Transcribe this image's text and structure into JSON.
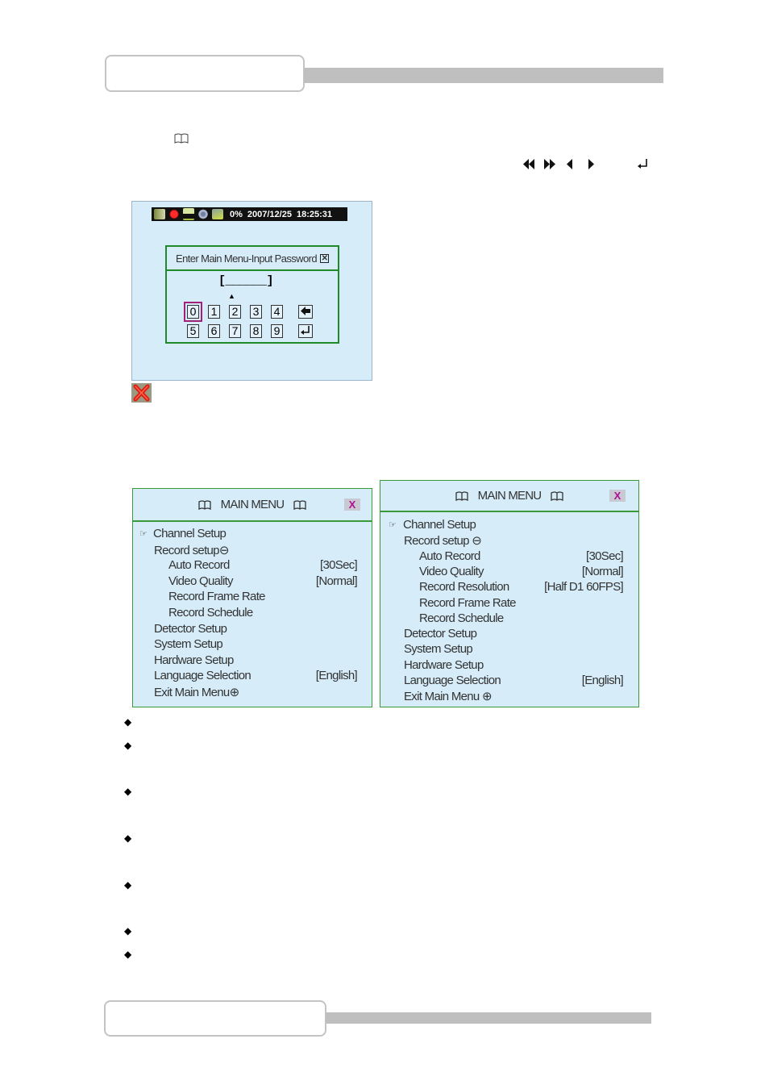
{
  "page": {
    "header_tab_label": "",
    "footer_tab_label": "",
    "note_icon": "book-icon",
    "nav_keys": [
      "fast-rewind-icon",
      "fast-forward-icon",
      "left-icon",
      "right-icon",
      "enter-icon"
    ],
    "nav_glyphs": {
      "rewind": "◀◀",
      "forward": "▶▶",
      "left": "◀",
      "right": "▶",
      "enter": "↵"
    }
  },
  "password_screen": {
    "status_bar": {
      "icons": [
        "camera-icon",
        "record-icon",
        "network-icon",
        "disk-icon",
        "hdd-icon"
      ],
      "percent": "0%",
      "date": "2007/12/25",
      "time": "18:25:31"
    },
    "dialog": {
      "title": "Enter Main Menu-Input Password",
      "close_glyph": "✕",
      "field": "[______]",
      "caret": "▲",
      "keys_row1": [
        "0",
        "1",
        "2",
        "3",
        "4"
      ],
      "keys_row2": [
        "5",
        "6",
        "7",
        "8",
        "9"
      ],
      "backspace_glyph": "🡐",
      "enter_glyph": "↵",
      "selected_key": "0"
    },
    "close_icon": "cancel-icon"
  },
  "menu_left": {
    "title": "MAIN MENU",
    "close_label": "X",
    "items": [
      {
        "label": "Channel Setup",
        "value": "",
        "level": 0,
        "pointer": "☞"
      },
      {
        "label": "Record setup⊖",
        "value": "",
        "level": 1
      },
      {
        "label": "Auto Record",
        "value": "[30Sec]",
        "level": 2
      },
      {
        "label": "Video Quality",
        "value": "[Normal]",
        "level": 2
      },
      {
        "label": "Record Frame Rate",
        "value": "",
        "level": 2
      },
      {
        "label": "Record Schedule",
        "value": "",
        "level": 2
      },
      {
        "label": "Detector Setup",
        "value": "",
        "level": 1
      },
      {
        "label": "System Setup",
        "value": "",
        "level": 1
      },
      {
        "label": "Hardware Setup",
        "value": "",
        "level": 1
      },
      {
        "label": "Language Selection",
        "value": "[English]",
        "level": 1
      },
      {
        "label": "Exit Main Menu⊕",
        "value": "",
        "level": 1
      }
    ]
  },
  "menu_right": {
    "title": "MAIN MENU",
    "close_label": "X",
    "items": [
      {
        "label": "Channel Setup",
        "value": "",
        "level": 0,
        "pointer": "☞"
      },
      {
        "label": "Record setup ⊖",
        "value": "",
        "level": 1
      },
      {
        "label": "Auto Record",
        "value": "[30Sec]",
        "level": 2
      },
      {
        "label": "Video Quality",
        "value": "[Normal]",
        "level": 2
      },
      {
        "label": "Record Resolution",
        "value": "[Half D1 60FPS]",
        "level": 2
      },
      {
        "label": "Record Frame Rate",
        "value": "",
        "level": 2
      },
      {
        "label": "Record Schedule",
        "value": "",
        "level": 2
      },
      {
        "label": "Detector Setup",
        "value": "",
        "level": 1
      },
      {
        "label": "System Setup",
        "value": "",
        "level": 1
      },
      {
        "label": "Hardware Setup",
        "value": "",
        "level": 1
      },
      {
        "label": "Language Selection",
        "value": "[English]",
        "level": 1
      },
      {
        "label": "Exit Main Menu ⊕",
        "value": "",
        "level": 1
      }
    ]
  },
  "bullets": {
    "glyph": "◆",
    "count": 7
  }
}
